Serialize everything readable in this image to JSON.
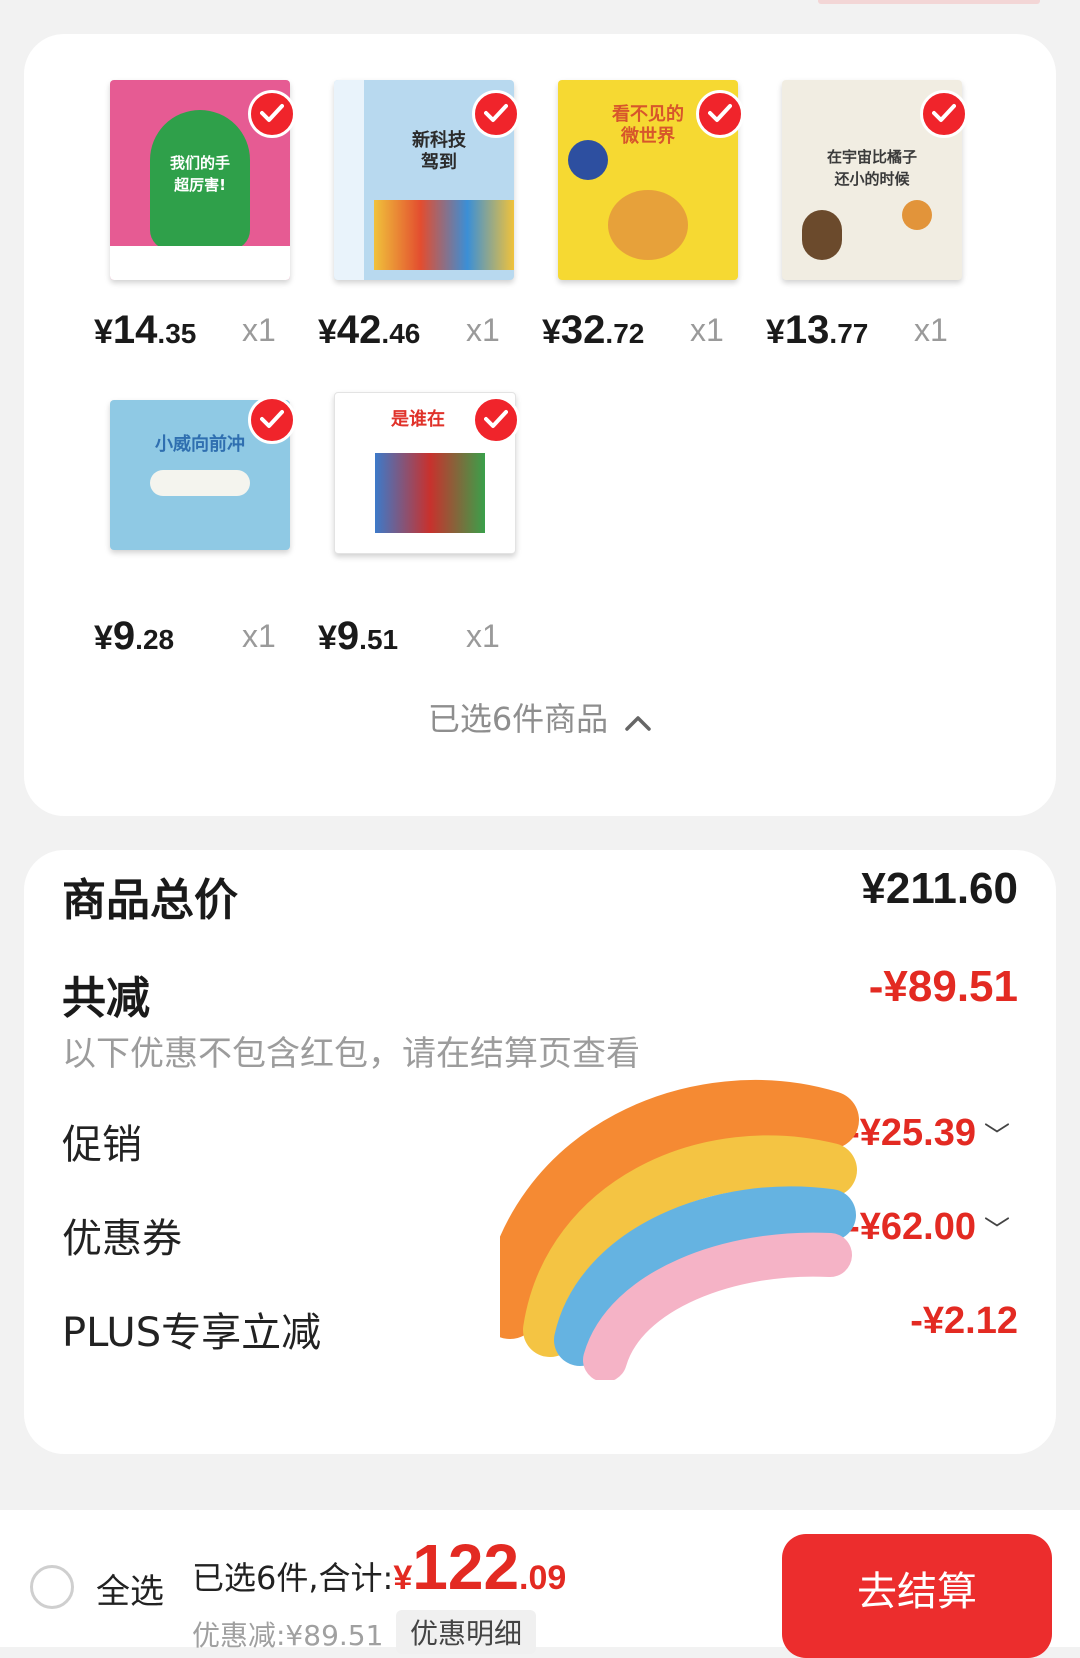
{
  "products_card": {
    "items": [
      {
        "cover_title": "我们的手\n超厉害!",
        "price_currency": "¥",
        "price_int": "14",
        "price_dec": ".35",
        "qty": "x1",
        "color_bg": "#e65b93",
        "color_fg": "#2fa04a"
      },
      {
        "cover_title": "新科技\n驾到",
        "price_currency": "¥",
        "price_int": "42",
        "price_dec": ".46",
        "qty": "x1",
        "color_bg": "#b8d9ef",
        "color_fg": "#2b2b2b"
      },
      {
        "cover_title": "看不见的\n微世界",
        "price_currency": "¥",
        "price_int": "32",
        "price_dec": ".72",
        "qty": "x1",
        "color_bg": "#f6d932",
        "color_fg": "#d7562b"
      },
      {
        "cover_title": "在宇宙比橘子\n还小的时候",
        "price_currency": "¥",
        "price_int": "13",
        "price_dec": ".77",
        "qty": "x1",
        "color_bg": "#f1ede2",
        "color_fg": "#3a3a3a"
      },
      {
        "cover_title": "小威向前冲",
        "price_currency": "¥",
        "price_int": "9",
        "price_dec": ".28",
        "qty": "x1",
        "color_bg": "#8fc9e4",
        "color_fg": "#2f6fb0"
      },
      {
        "cover_title": "是谁在",
        "price_currency": "¥",
        "price_int": "9",
        "price_dec": ".51",
        "qty": "x1",
        "color_bg": "#ffffff",
        "color_fg": "#e0322a"
      }
    ],
    "selected_toggle_label": "已选6件商品"
  },
  "summary": {
    "total_label": "商品总价",
    "total_value": "¥211.60",
    "reduce_label": "共减",
    "reduce_value": "-¥89.51",
    "hint": "以下优惠不包含红包，请在结算页查看",
    "promo_label": "促销",
    "promo_value": "-¥25.39",
    "coupon_label": "优惠券",
    "coupon_value": "-¥62.00",
    "plus_label": "PLUS专享立减",
    "plus_value": "-¥2.12"
  },
  "bottom_bar": {
    "select_all": "全选",
    "selected_total_label": "已选6件,合计:",
    "total_currency": "¥",
    "total_int": "122",
    "total_dec": ".09",
    "discount_line": "优惠减:¥89.51",
    "detail_button": "优惠明细",
    "checkout_button": "去结算"
  },
  "colors": {
    "accent_red": "#e32a22",
    "checkout_red": "#ec2d2d",
    "check_red": "#f0242b"
  },
  "icons": [
    "check-icon",
    "chevron-up-icon",
    "chevron-down-icon",
    "radio-unchecked-icon",
    "rainbow-sticker"
  ]
}
